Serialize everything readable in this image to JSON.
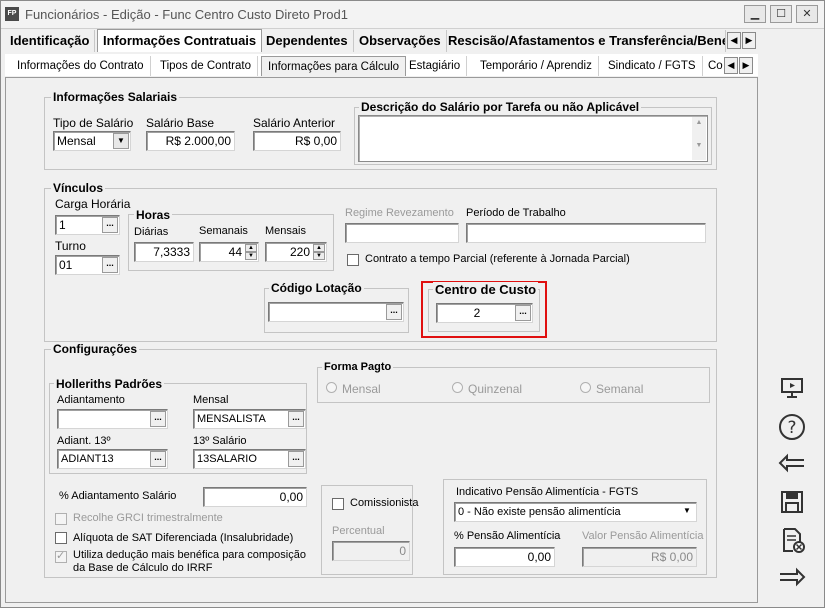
{
  "window": {
    "title": "Funcionários - Edição - Func Centro Custo Direto Prod1",
    "app_badge": "FP"
  },
  "tabs_main": [
    {
      "label": "Identificação"
    },
    {
      "label": "Informações Contratuais"
    },
    {
      "label": "Dependentes"
    },
    {
      "label": "Observações"
    },
    {
      "label": "Rescisão/Afastamentos e Transferência/Bene"
    }
  ],
  "tabs_sub": [
    {
      "label": "Informações do Contrato"
    },
    {
      "label": "Tipos de Contrato"
    },
    {
      "label": "Informações para Cálculo"
    },
    {
      "label": "Estagiário"
    },
    {
      "label": "Temporário / Aprendiz"
    },
    {
      "label": "Sindicato / FGTS"
    },
    {
      "label": "Co"
    }
  ],
  "salariais": {
    "title": "Informações Salariais",
    "tipo_label": "Tipo de Salário",
    "tipo_value": "Mensal",
    "base_label": "Salário Base",
    "base_value": "R$ 2.000,00",
    "anterior_label": "Salário Anterior",
    "anterior_value": "R$ 0,00",
    "descricao_title": "Descrição do Salário por Tarefa ou não Aplicável"
  },
  "vinculos": {
    "title": "Vínculos",
    "carga_label": "Carga Horária",
    "carga_value": "1",
    "turno_label": "Turno",
    "turno_value": "01",
    "horas_title": "Horas",
    "diarias_label": "Diárias",
    "diarias_value": "7,3333",
    "semanais_label": "Semanais",
    "semanais_value": "44",
    "mensais_label": "Mensais",
    "mensais_value": "220",
    "regime_label": "Regime Revezamento",
    "periodo_label": "Período de Trabalho",
    "parcial_label": "Contrato a tempo Parcial (referente à Jornada Parcial)",
    "lotacao_title": "Código Lotação",
    "lotacao_value": "",
    "centro_title": "Centro de Custo",
    "centro_value": "2"
  },
  "config": {
    "title": "Configurações",
    "holleriths_title": "Holleriths Padrões",
    "adiantamento_label": "Adiantamento",
    "adiantamento_value": "",
    "mensal_label": "Mensal",
    "mensal_value": "MENSALISTA",
    "adiant13_label": "Adiant. 13º",
    "adiant13_value": "ADIANT13",
    "sal13_label": "13º Salário",
    "sal13_value": "13SALARIO",
    "forma_title": "Forma Pagto",
    "forma_options": [
      "Mensal",
      "Quinzenal",
      "Semanal"
    ],
    "perc_adiant_label": "% Adiantamento Salário",
    "perc_adiant_value": "0,00",
    "grci_label": "Recolhe GRCI trimestralmente",
    "sat_label": "Alíquota de SAT Diferenciada (Insalubridade)",
    "deducao_label": "Utiliza dedução mais benéfica para composição da Base de Cálculo do IRRF",
    "comissionista_label": "Comissionista",
    "percentual_label": "Percentual",
    "percentual_value": "0",
    "pensao_ind_label": "Indicativo Pensão Alimentícia - FGTS",
    "pensao_ind_value": "0 - Não existe pensão alimentícia",
    "perc_pensao_label": "% Pensão Alimentícia",
    "perc_pensao_value": "0,00",
    "valor_pensao_label": "Valor Pensão Alimentícia",
    "valor_pensao_value": "R$ 0,00"
  },
  "icons": [
    "presentation-icon",
    "help-icon",
    "back-arrow-icon",
    "save-icon",
    "cancel-document-icon",
    "forward-arrow-icon"
  ]
}
